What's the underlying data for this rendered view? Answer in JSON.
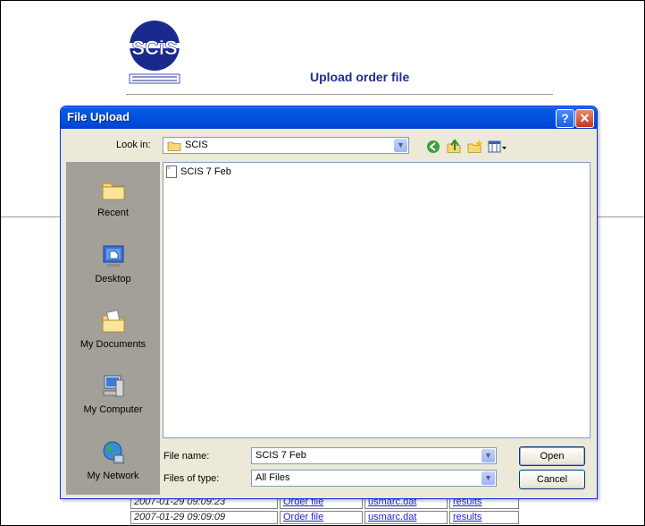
{
  "page": {
    "logo_text": "SCiS",
    "logo_subtext": "SCHOOLS CATALOGUE INFORMATION SERVICE",
    "title": "Upload order file"
  },
  "table": {
    "rows": [
      {
        "date": "2007-01-29 09:09:23",
        "order": "Order file",
        "file": "usmarc.dat",
        "results": "results"
      },
      {
        "date": "2007-01-29 09:09:09",
        "order": "Order file",
        "file": "usmarc.dat",
        "results": "results"
      }
    ]
  },
  "dialog": {
    "title": "File Upload",
    "help_label": "?",
    "close_label": "✕",
    "look_in_label": "Look in:",
    "look_in_value": "SCIS",
    "places": [
      {
        "label": "Recent",
        "icon": "recent-folder-icon"
      },
      {
        "label": "Desktop",
        "icon": "desktop-icon"
      },
      {
        "label": "My Documents",
        "icon": "my-documents-icon"
      },
      {
        "label": "My Computer",
        "icon": "my-computer-icon"
      },
      {
        "label": "My Network",
        "icon": "my-network-icon"
      }
    ],
    "files": [
      {
        "name": "SCIS 7 Feb",
        "icon": "text-file-icon"
      }
    ],
    "file_name_label": "File name:",
    "file_name_value": "SCIS 7 Feb",
    "files_of_type_label": "Files of type:",
    "files_of_type_value": "All Files",
    "open_label": "Open",
    "cancel_label": "Cancel",
    "toolbar_icons": [
      "back-icon",
      "up-folder-icon",
      "new-folder-icon",
      "view-menu-icon"
    ]
  },
  "colors": {
    "titlebar": "#0052e2",
    "dialog_bg": "#ece9d8",
    "places_bg": "#a3a09a",
    "page_title": "#1f2d8f",
    "link": "#2222cc"
  }
}
